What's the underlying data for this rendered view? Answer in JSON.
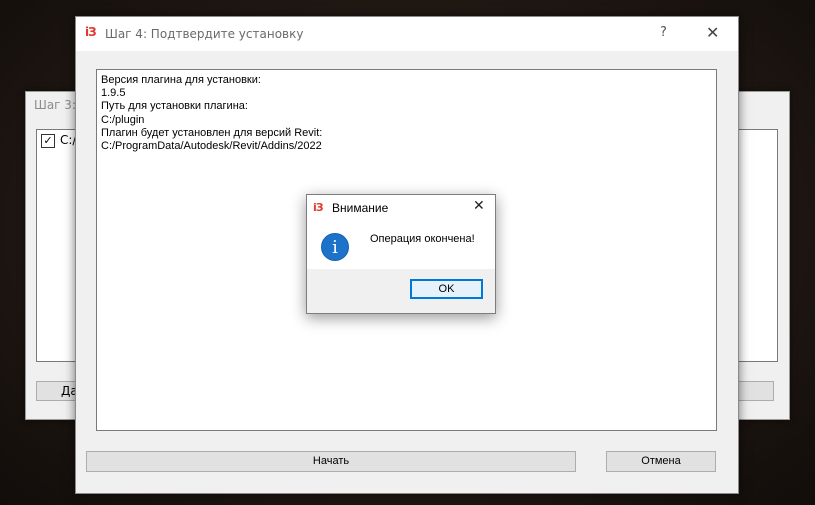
{
  "back_window": {
    "title": "Шаг 3: В",
    "checkbox_label": "C:/",
    "left_button_label": "Да"
  },
  "main_window": {
    "app_icon": "iЗ",
    "title": "Шаг 4: Подтвердите установку",
    "help_symbol": "?",
    "close_symbol": "✕",
    "output_lines": [
      "Версия плагина для установки:",
      "1.9.5",
      "Путь для установки плагина:",
      "C:/plugin",
      "Плагин будет установлен для версий Revit:",
      "C:/ProgramData/Autodesk/Revit/Addins/2022"
    ],
    "start_button": "Начать",
    "cancel_button": "Отмена"
  },
  "message_box": {
    "app_icon": "iЗ",
    "title": "Внимание",
    "close_symbol": "✕",
    "icon": "info-icon",
    "icon_glyph": "i",
    "message": "Операция окончена!",
    "ok_button": "OK"
  },
  "colors": {
    "accent": "#0078d7",
    "info_icon": "#1d72c9",
    "app_icon": "#e03a2e"
  }
}
